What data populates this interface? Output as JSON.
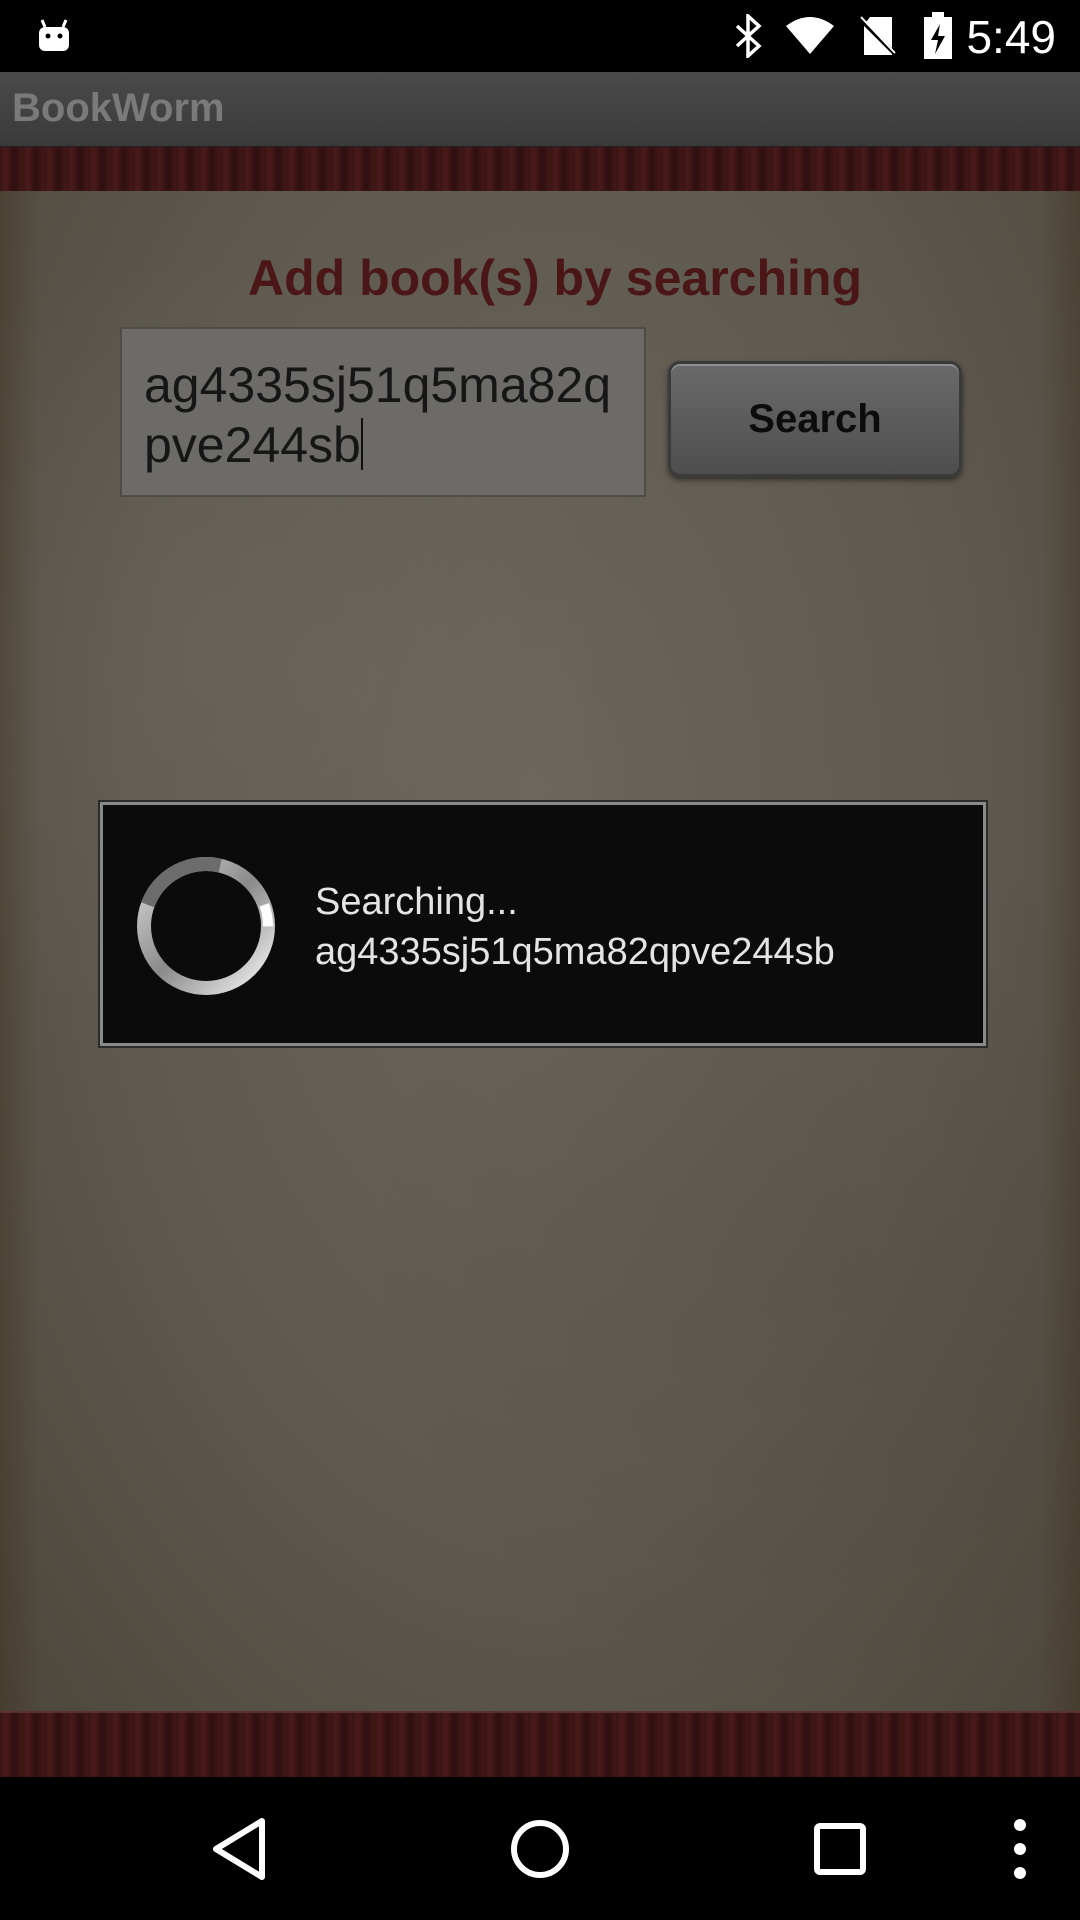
{
  "status_bar": {
    "time": "5:49",
    "icons": [
      "android-notification-icon",
      "bluetooth-icon",
      "wifi-icon",
      "no-sim-icon",
      "battery-charging-icon"
    ]
  },
  "app": {
    "title": "BookWorm"
  },
  "main": {
    "heading": "Add book(s) by searching",
    "search_value": "ag4335sj51q5ma82qpve244sb",
    "search_button_label": "Search"
  },
  "dialog": {
    "status": "Searching...",
    "query": "ag4335sj51q5ma82qpve244sb"
  },
  "nav_bar": {
    "buttons": [
      "back-icon",
      "home-icon",
      "recents-icon",
      "overflow-menu-icon"
    ]
  },
  "colors": {
    "heading": "#4b1616",
    "dialog_bg": "#0b0b0b",
    "parchment": "#5f5a50"
  }
}
